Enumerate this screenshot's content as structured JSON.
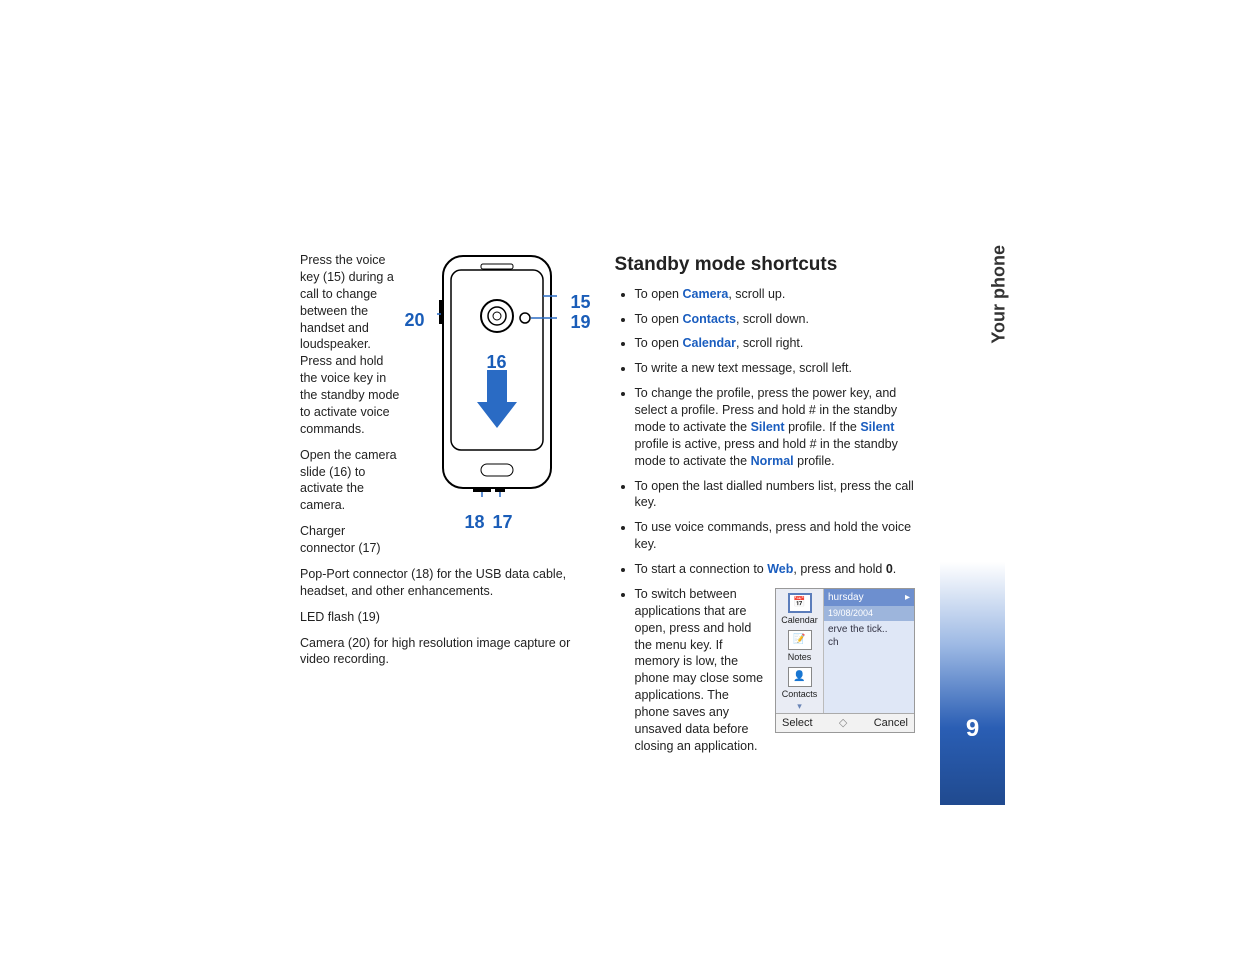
{
  "sidebar": {
    "section": "Your phone",
    "page_number": "9"
  },
  "left": {
    "p1": "Press the voice key (15) during a call to change between the handset and loudspeaker. Press and hold the voice key in the standby mode to activate voice commands.",
    "p2": "Open the camera slide (16) to activate the camera.",
    "p3": "Charger connector (17)",
    "p4": "Pop-Port connector (18) for the USB data cable, headset, and other enhancements.",
    "p5": "LED flash (19)",
    "p6": "Camera (20) for high resolution image capture or video recording."
  },
  "callouts": {
    "c15": "15",
    "c16": "16",
    "c17": "17",
    "c18": "18",
    "c19": "19",
    "c20": "20"
  },
  "right": {
    "heading": "Standby mode shortcuts",
    "li1_a": "To open ",
    "li1_kw": "Camera",
    "li1_b": ", scroll up.",
    "li2_a": "To open ",
    "li2_kw": "Contacts",
    "li2_b": ", scroll down.",
    "li3_a": "To open ",
    "li3_kw": "Calendar",
    "li3_b": ", scroll right.",
    "li4": "To write a new text message, scroll left.",
    "li5_a": "To change the profile, press the power key, and select a profile. Press and hold # in the standby mode to activate the ",
    "li5_kw1": "Silent",
    "li5_b": " profile. If the ",
    "li5_kw2": "Silent",
    "li5_c": " profile is active, press and hold # in the standby mode to activate the ",
    "li5_kw3": "Normal",
    "li5_d": " profile.",
    "li6": "To open the last dialled numbers list, press the call key.",
    "li7": "To use voice commands, press and hold the voice key.",
    "li8_a": "To start a connection to ",
    "li8_kw": "Web",
    "li8_b": ", press and hold ",
    "li8_bold": "0",
    "li8_c": ".",
    "li9": "To switch between applications that are open, press and hold the menu key. If memory is low, the phone may close some applications. The phone saves any unsaved data before closing an application."
  },
  "screenshot": {
    "day": "hursday",
    "date": "19/08/2004",
    "line1": "erve the tick..",
    "line2": "ch",
    "side1": "Calendar",
    "side2": "Notes",
    "side3": "Contacts",
    "select": "Select",
    "cancel": "Cancel"
  }
}
